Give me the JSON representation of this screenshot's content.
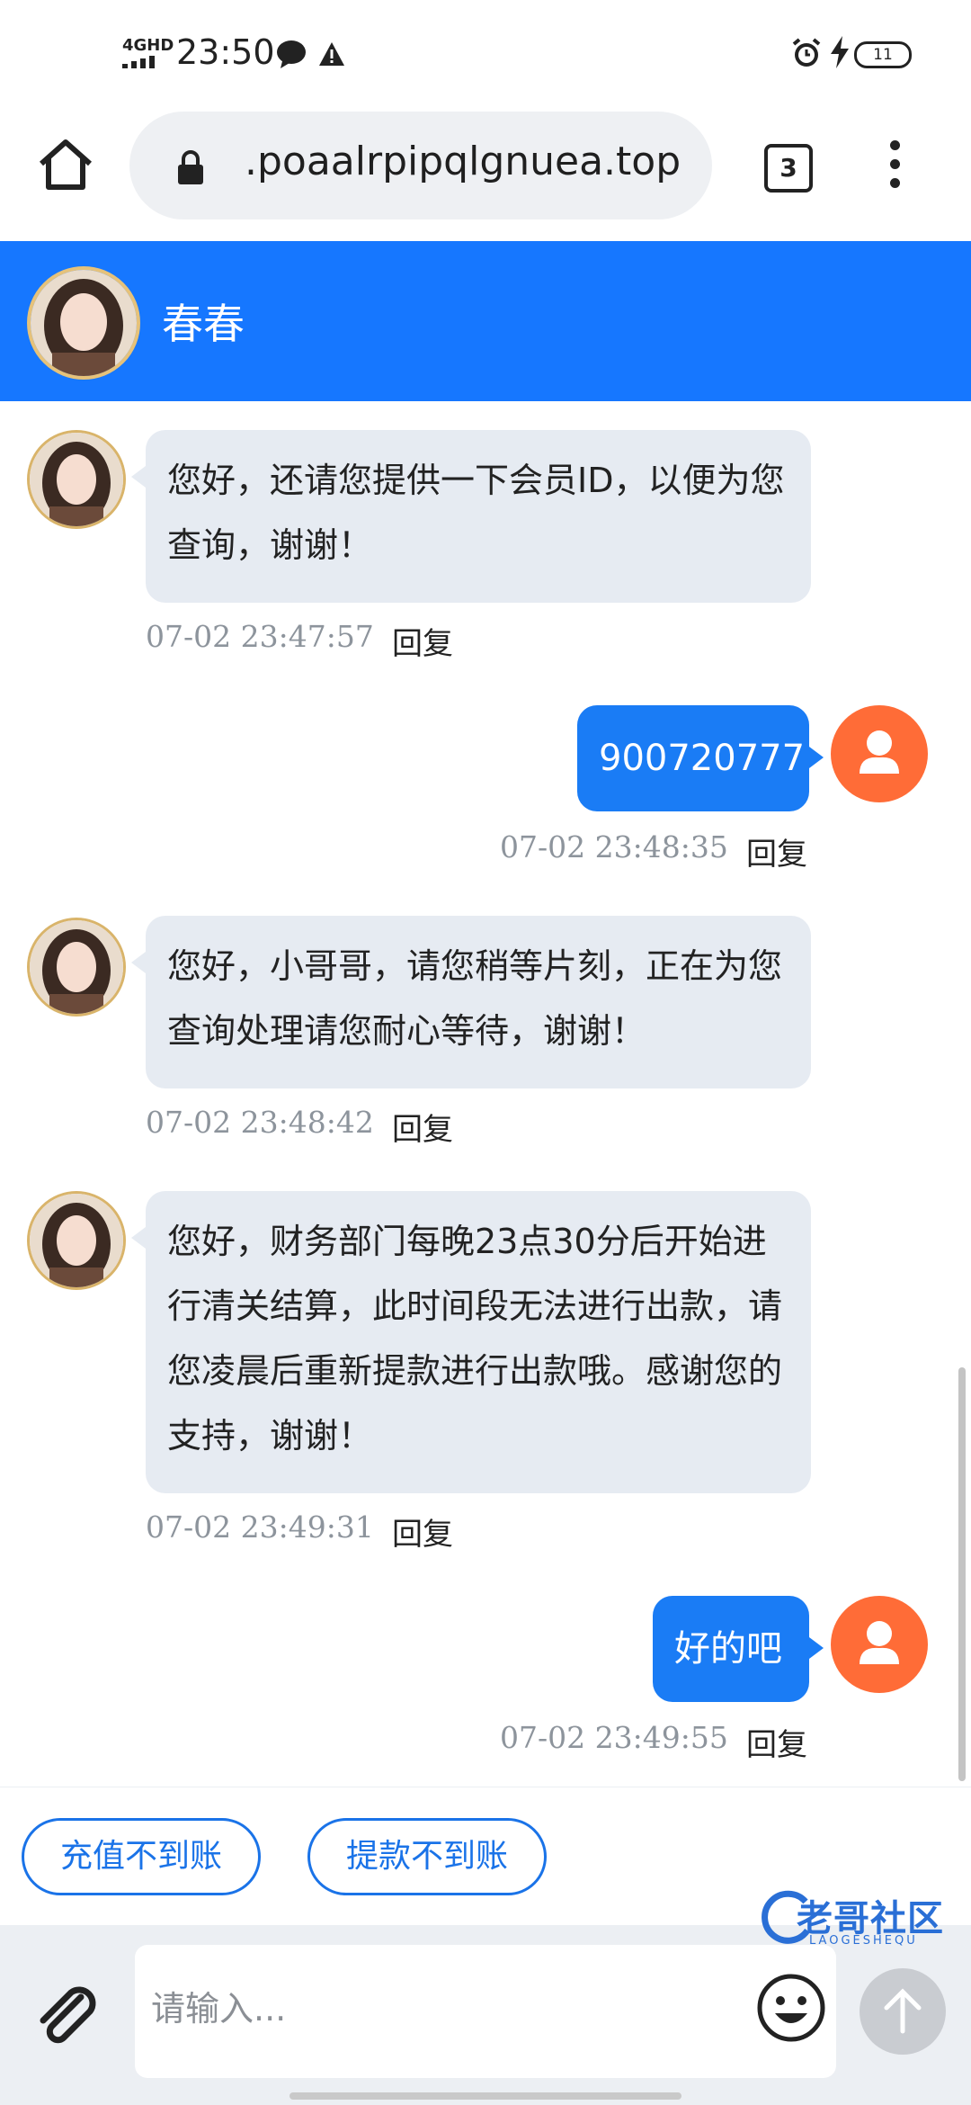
{
  "status_bar": {
    "network": "4GHD",
    "time": "23:50",
    "battery": "11"
  },
  "browser": {
    "url": ".poaalrpipqlgnuea.top",
    "tab_count": "3"
  },
  "chat": {
    "agent_name": "春春",
    "messages": [
      {
        "from": "agent",
        "text": "您好，还请您提供一下会员ID，以便为您查询，谢谢！",
        "time": "07-02 23:47:57",
        "reply": "回复"
      },
      {
        "from": "user",
        "text": "900720777",
        "time": "07-02 23:48:35",
        "reply": "回复"
      },
      {
        "from": "agent",
        "text": "您好，小哥哥，请您稍等片刻，正在为您查询处理请您耐心等待，谢谢！",
        "time": "07-02 23:48:42",
        "reply": "回复"
      },
      {
        "from": "agent",
        "text": "您好，财务部门每晚23点30分后开始进行清关结算，此时间段无法进行出款，请您凌晨后重新提款进行出款哦。感谢您的支持，谢谢！",
        "time": "07-02 23:49:31",
        "reply": "回复"
      },
      {
        "from": "user",
        "text": "好的吧",
        "time": "07-02 23:49:55",
        "reply": "回复"
      }
    ]
  },
  "quick_replies": [
    "充值不到账",
    "提款不到账"
  ],
  "input": {
    "placeholder": "请输入..."
  },
  "watermark": {
    "text": "老哥社区",
    "sub": "LAOGESHEQU"
  },
  "colors": {
    "header": "#1677ff",
    "user_bubble": "#1a7cf5",
    "agent_bubble": "#e6ebf2",
    "user_avatar": "#ff6c37"
  }
}
